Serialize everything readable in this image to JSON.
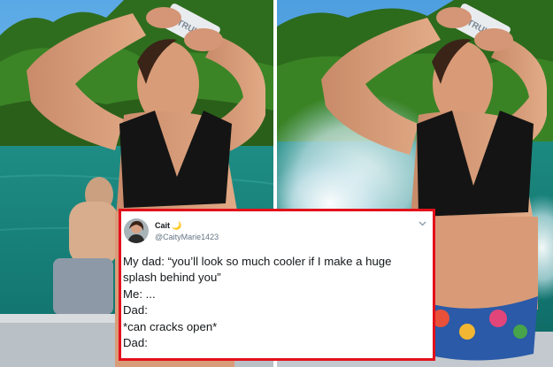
{
  "tweet": {
    "name": "Cait",
    "name_emoji": "🌙",
    "handle": "@CaityMarie1423",
    "lines": [
      "My dad: “you’ll look so much cooler if I make a huge",
      "splash behind you”",
      "Me: ...",
      "Dad:",
      "*can cracks open*",
      "Dad:"
    ],
    "border_color": "#e3101b"
  },
  "photos": {
    "left": {
      "can_label": "TRULY"
    },
    "right": {
      "can_label": "TRULY"
    }
  },
  "icons": {
    "tweet_menu": "chevron-down-icon",
    "name_emoji": "crescent-moon-icon"
  }
}
